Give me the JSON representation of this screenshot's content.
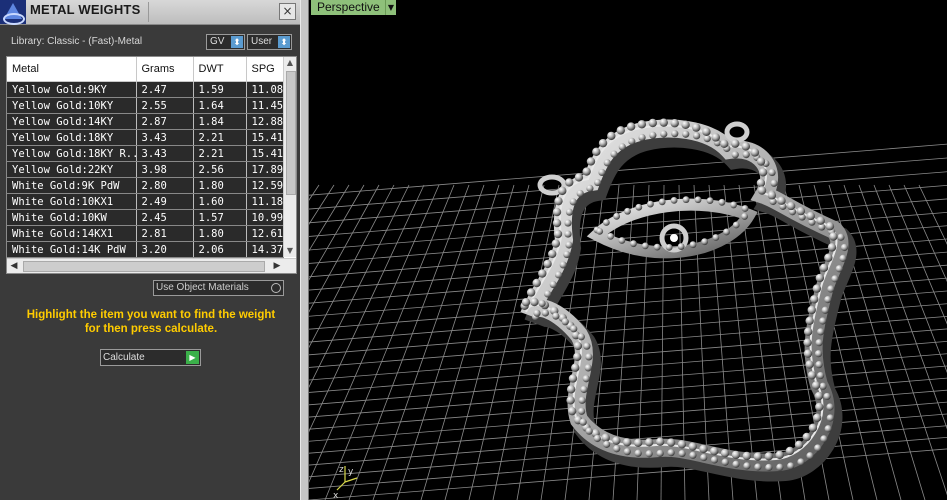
{
  "panel": {
    "title": "METAL WEIGHTS",
    "close_glyph": "×",
    "library_label": "Library: Classic - (Fast)-Metal",
    "gv_label": "GV",
    "user_label": "User",
    "dropdown_arrow": "⬍"
  },
  "table": {
    "columns": [
      "Metal",
      "Grams",
      "DWT",
      "SPG"
    ],
    "rows": [
      [
        "Yellow Gold:9KY",
        "2.47",
        "1.59",
        "11.08"
      ],
      [
        "Yellow Gold:10KY",
        "2.55",
        "1.64",
        "11.45"
      ],
      [
        "Yellow Gold:14KY",
        "2.87",
        "1.84",
        "12.88"
      ],
      [
        "Yellow Gold:18KY",
        "3.43",
        "2.21",
        "15.41"
      ],
      [
        "Yellow Gold:18KY R...",
        "3.43",
        "2.21",
        "15.41"
      ],
      [
        "Yellow Gold:22KY",
        "3.98",
        "2.56",
        "17.89"
      ],
      [
        "White Gold:9K PdW",
        "2.80",
        "1.80",
        "12.59"
      ],
      [
        "White Gold:10KX1",
        "2.49",
        "1.60",
        "11.18"
      ],
      [
        "White Gold:10KW",
        "2.45",
        "1.57",
        "10.99"
      ],
      [
        "White Gold:14KX1",
        "2.81",
        "1.80",
        "12.61"
      ],
      [
        "White Gold:14K PdW",
        "3.20",
        "2.06",
        "14.37"
      ]
    ]
  },
  "use_object_materials_label": "Use Object Materials",
  "hint_line1": "Highlight the item you want to find the weight",
  "hint_line2": "for then press calculate.",
  "calculate_label": "Calculate",
  "viewport": {
    "view_name": "Perspective",
    "axis_z": "z",
    "axis_y": "y",
    "axis_x": "x"
  },
  "colors": {
    "panel_bg": "#3a3a3a",
    "hint_yellow": "#ffcc00",
    "view_label_green": "#8ec07a",
    "calc_green": "#3bb04a"
  }
}
